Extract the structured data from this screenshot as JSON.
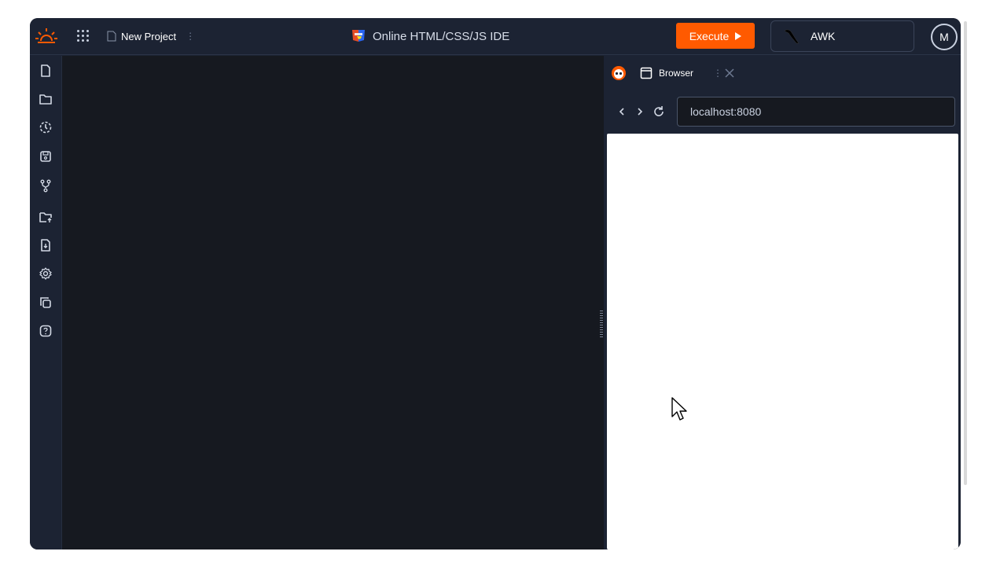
{
  "header": {
    "logo_icon": "sun-logo-icon",
    "apps_icon": "grid-icon",
    "project_name": "New Project",
    "project_menu": "⋮",
    "title": "Online HTML/CSS/JS IDE",
    "execute_label": "Execute",
    "language": "AWK",
    "avatar_initial": "M"
  },
  "sidebar": {
    "items": [
      {
        "icon": "new-file-icon"
      },
      {
        "icon": "folder-icon"
      },
      {
        "icon": "history-icon"
      },
      {
        "icon": "save-icon"
      },
      {
        "icon": "git-branch-icon"
      },
      {
        "icon": "folder-upload-icon"
      },
      {
        "icon": "download-file-icon"
      },
      {
        "icon": "settings-icon"
      },
      {
        "icon": "copy-icon"
      },
      {
        "icon": "help-icon"
      }
    ]
  },
  "preview": {
    "tab_label": "Browser",
    "tab_menu": "⋮",
    "url": "localhost:8080"
  },
  "colors": {
    "accent": "#ff5a00",
    "panel": "#1c2333",
    "editor": "#161920"
  }
}
